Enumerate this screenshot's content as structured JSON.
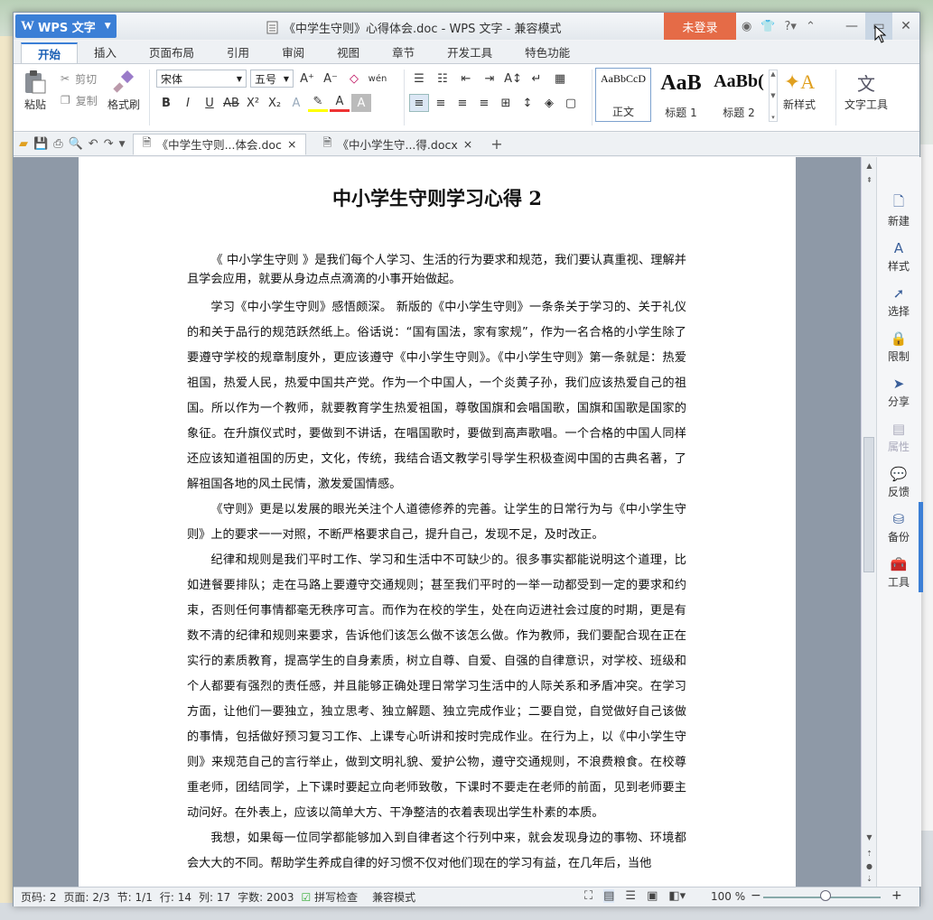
{
  "app": {
    "name": "WPS 文字",
    "logo": "W"
  },
  "window": {
    "title": "《中学生守则》心得体会.doc - WPS 文字 - 兼容模式",
    "login": "未登录"
  },
  "ribbon_tabs": [
    "开始",
    "插入",
    "页面布局",
    "引用",
    "审阅",
    "视图",
    "章节",
    "开发工具",
    "特色功能"
  ],
  "ribbon": {
    "paste": "粘贴",
    "cut": "剪切",
    "copy": "复制",
    "format_painter": "格式刷",
    "font": "宋体",
    "size": "五号",
    "styles": [
      {
        "sample": "AaBbCcD",
        "name": "正文"
      },
      {
        "sample": "AaB",
        "name": "标题 1"
      },
      {
        "sample": "AaBb(",
        "name": "标题 2"
      }
    ],
    "new_style": "新样式",
    "text_tools": "文字工具"
  },
  "doc_tabs": [
    "《中学生守则...体会.doc",
    "《中小学生守...得.docx"
  ],
  "document": {
    "heading": "中小学生守则学习心得 2",
    "paragraphs": [
      "《 中小学生守则 》是我们每个人学习、生活的行为要求和规范，我们要认真重视、理解并且学会应用，就要从身边点点滴滴的小事开始做起。",
      "学习《中小学生守则》感悟颇深。 新版的《中小学生守则》一条条关于学习的、关于礼仪的和关于品行的规范跃然纸上。俗话说：“国有国法，家有家规”，作为一名合格的小学生除了要遵守学校的规章制度外，更应该遵守《中小学生守则》。《中小学生守则》第一条就是：热爱祖国，热爱人民，热爱中国共产党。作为一个中国人，一个炎黄子孙，我们应该热爱自己的祖国。所以作为一个教师，就要教育学生热爱祖国，尊敬国旗和会唱国歌，国旗和国歌是国家的象征。在升旗仪式时，要做到不讲话，在唱国歌时，要做到高声歌唱。一个合格的中国人同样还应该知道祖国的历史，文化，传统，我结合语文教学引导学生积极查阅中国的古典名著，了解祖国各地的风土民情，激发爱国情感。",
      "《守则》更是以发展的眼光关注个人道德修养的完善。让学生的日常行为与《中小学生守则》上的要求一一对照，不断严格要求自己，提升自己，发现不足，及时改正。",
      "纪律和规则是我们平时工作、学习和生活中不可缺少的。很多事实都能说明这个道理，比如进餐要排队；走在马路上要遵守交通规则；甚至我们平时的一举一动都受到一定的要求和约束，否则任何事情都毫无秩序可言。而作为在校的学生，处在向迈进社会过度的时期，更是有数不清的纪律和规则来要求，告诉他们该怎么做不该怎么做。作为教师，我们要配合现在正在实行的素质教育，提高学生的自身素质，树立自尊、自爱、自强的自律意识，对学校、班级和个人都要有强烈的责任感，并且能够正确处理日常学习生活中的人际关系和矛盾冲突。在学习方面，让他们一要独立，独立思考、独立解题、独立完成作业；二要自觉，自觉做好自己该做的事情，包括做好预习复习工作、上课专心听讲和按时完成作业。在行为上，以《中小学生守则》来规范自己的言行举止，做到文明礼貌、爱护公物，遵守交通规则，不浪费粮食。在校尊重老师，团结同学，上下课时要起立向老师致敬，下课时不要走在老师的前面，见到老师要主动问好。在外表上，应该以简单大方、干净整洁的衣着表现出学生朴素的本质。",
      "我想，如果每一位同学都能够加入到自律者这个行列中来，就会发现身边的事物、环境都会大大的不同。帮助学生养成自律的好习惯不仅对他们现在的学习有益，在几年后，当他"
    ]
  },
  "taskpane": [
    "新建",
    "样式",
    "选择",
    "限制",
    "分享",
    "属性",
    "反馈",
    "备份",
    "工具"
  ],
  "status": {
    "page_code": "页码: 2",
    "pages": "页面: 2/3",
    "section": "节: 1/1",
    "row": "行: 14",
    "col": "列: 17",
    "words": "字数: 2003",
    "spell": "拼写检查",
    "mode": "兼容模式",
    "zoom": "100 %"
  }
}
